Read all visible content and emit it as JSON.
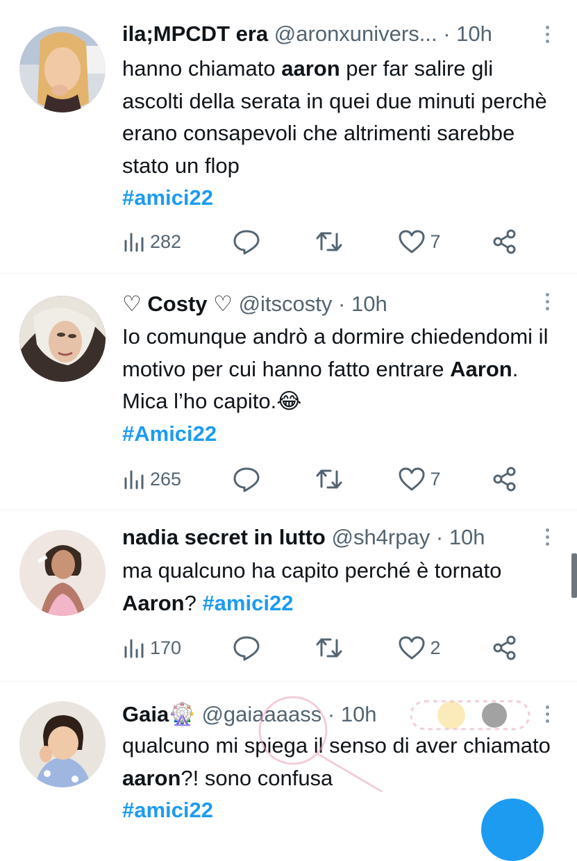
{
  "tweets": [
    {
      "name": "ila;MPCDT era",
      "handle": "@aronxunivers...",
      "dot": "·",
      "time": "10h",
      "text_1": "hanno chiamato ",
      "bold_1": "aaron",
      "text_2": " per far salire gli ascolti della serata in quei due minuti perchè erano consapevoli che altrimenti sarebbe stato un flop",
      "bold_2": "",
      "text_3": "",
      "hashtag": "#amici22",
      "views": "282",
      "replies": "",
      "retweets": "",
      "likes": "7"
    },
    {
      "name": "♡ Costy ♡",
      "handle": "@itscosty",
      "dot": "·",
      "time": "10h",
      "text_1": "Io comunque andrò a dormire chiedendomi  il motivo per cui hanno fatto entrare ",
      "bold_1": "Aaron",
      "text_2": ". Mica l’ho capito.😂",
      "bold_2": "",
      "text_3": "",
      "hashtag": "#Amici22",
      "views": "265",
      "replies": "",
      "retweets": "",
      "likes": "7"
    },
    {
      "name": "nadia secret in lutto",
      "handle": "@sh4rpay",
      "dot": "·",
      "time": "10h",
      "text_1": "ma qualcuno ha capito perché è tornato ",
      "bold_1": "Aaron",
      "text_2": "? ",
      "bold_2": "",
      "text_3": "",
      "hashtag": "#amici22",
      "views": "170",
      "replies": "",
      "retweets": "",
      "likes": "2"
    },
    {
      "name": "Gaia🎡",
      "handle": "@gaiaaaass",
      "dot": "·",
      "time": "10h",
      "text_1": "qualcuno mi spiega il senso di aver chiamato ",
      "bold_1": "aaron",
      "text_2": "?! sono confusa",
      "bold_2": "",
      "text_3": "",
      "hashtag": "#amici22",
      "views": "",
      "replies": "",
      "retweets": "",
      "likes": ""
    }
  ],
  "colors": {
    "link": "#1d9bf0",
    "secondary": "#536471",
    "text": "#0f1419",
    "divider": "#eff3f4"
  },
  "icons": [
    "views-icon",
    "reply-icon",
    "retweet-icon",
    "like-icon",
    "share-icon",
    "more-icon"
  ]
}
